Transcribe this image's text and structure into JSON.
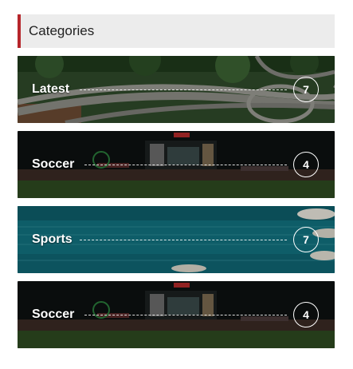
{
  "widget": {
    "title": "Categories",
    "accent_color": "#b6262b"
  },
  "categories": [
    {
      "name": "Latest",
      "count": "7",
      "image": "aerial-highway-interchange"
    },
    {
      "name": "Soccer",
      "count": "4",
      "image": "night-stadium"
    },
    {
      "name": "Sports",
      "count": "7",
      "image": "turquoise-sea-boats"
    },
    {
      "name": "Soccer",
      "count": "4",
      "image": "night-stadium"
    }
  ]
}
